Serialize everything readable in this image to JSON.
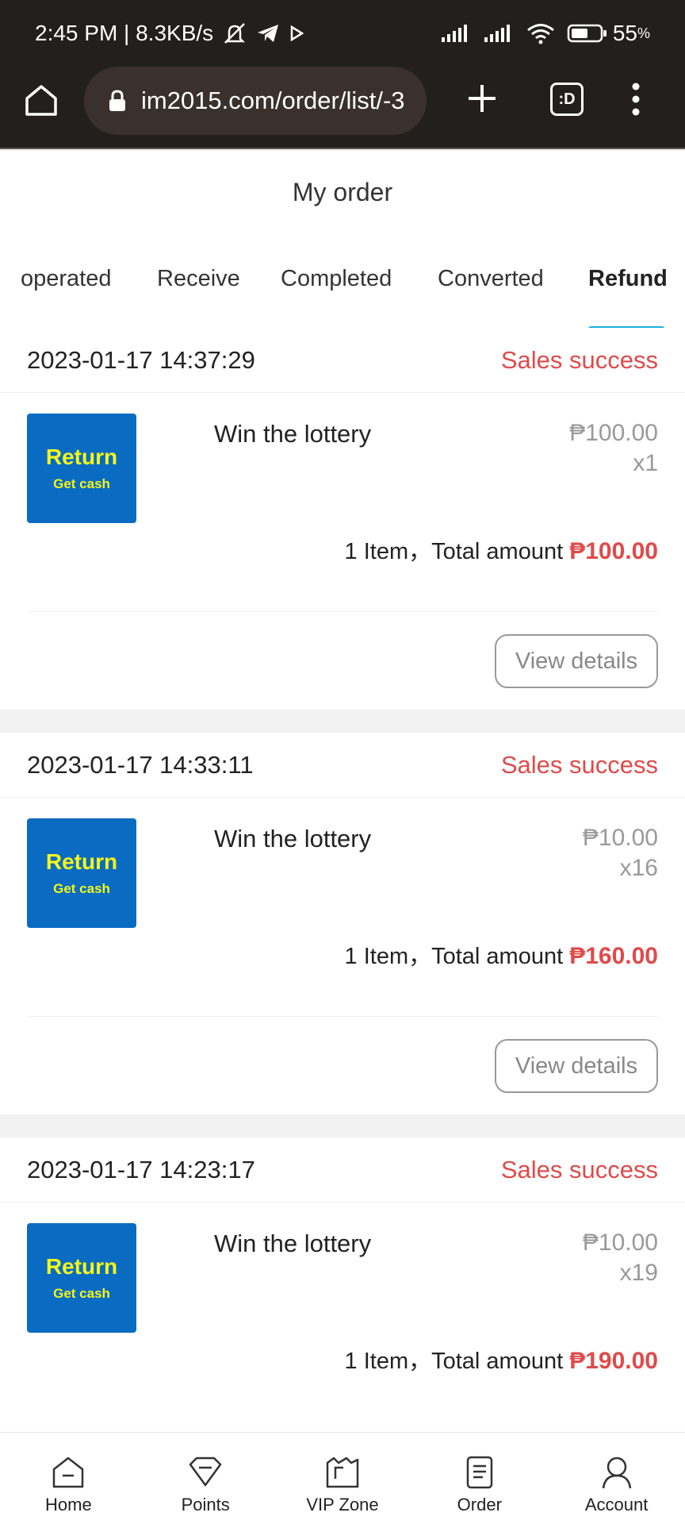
{
  "status_bar": {
    "left_text": "2:45 PM | 8.3KB/s",
    "battery": "55",
    "battery_unit": "%"
  },
  "browser": {
    "url": "im2015.com/order/list/-3",
    "tabs_label": ":D"
  },
  "page": {
    "title": "My order"
  },
  "tabs": [
    {
      "label": "operated"
    },
    {
      "label": "Receive"
    },
    {
      "label": "Completed"
    },
    {
      "label": "Converted"
    },
    {
      "label": "Refund",
      "active": true
    }
  ],
  "orders": [
    {
      "date": "2023-01-17 14:37:29",
      "status": "Sales success",
      "thumb_title": "Return",
      "thumb_sub": "Get cash",
      "product": "Win the lottery",
      "price": "₱100.00",
      "qty": "x1",
      "summary": "1 Item，Total amount",
      "total": "₱100.00",
      "button": "View details"
    },
    {
      "date": "2023-01-17 14:33:11",
      "status": "Sales success",
      "thumb_title": "Return",
      "thumb_sub": "Get cash",
      "product": "Win the lottery",
      "price": "₱10.00",
      "qty": "x16",
      "summary": "1 Item，Total amount",
      "total": "₱160.00",
      "button": "View details"
    },
    {
      "date": "2023-01-17 14:23:17",
      "status": "Sales success",
      "thumb_title": "Return",
      "thumb_sub": "Get cash",
      "product": "Win the lottery",
      "price": "₱10.00",
      "qty": "x19",
      "summary": "1 Item，Total amount",
      "total": "₱190.00"
    }
  ],
  "bottom_nav": [
    {
      "label": "Home",
      "icon": "home-icon"
    },
    {
      "label": "Points",
      "icon": "points-icon"
    },
    {
      "label": "VIP Zone",
      "icon": "vip-icon"
    },
    {
      "label": "Order",
      "icon": "order-icon"
    },
    {
      "label": "Account",
      "icon": "account-icon"
    }
  ],
  "colors": {
    "accent": "#1ab0e0",
    "status_red": "#e04a4a",
    "thumb_blue": "#0a6bc2",
    "thumb_yellow": "#f4f71a",
    "browser_bg": "#231f1d"
  }
}
